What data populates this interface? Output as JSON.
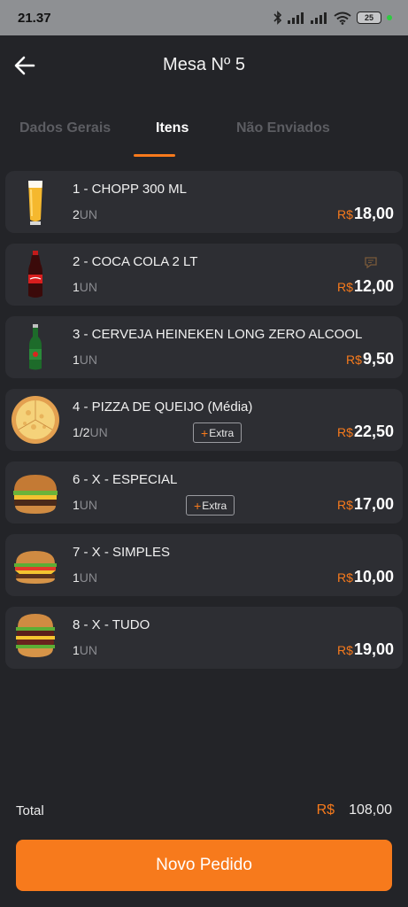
{
  "status_bar": {
    "time": "21.37",
    "battery": "25"
  },
  "header": {
    "title": "Mesa Nº 5"
  },
  "tabs": [
    {
      "label": "Dados Gerais",
      "active": false
    },
    {
      "label": "Itens",
      "active": true
    },
    {
      "label": "Não Enviados",
      "active": false
    }
  ],
  "currency": "R$",
  "items": [
    {
      "name": "1 - CHOPP 300 ML",
      "qty": "2",
      "unit": "UN",
      "price": "18,00",
      "image": "beer-glass",
      "has_note": false,
      "has_extra": false
    },
    {
      "name": "2 - COCA COLA 2 LT",
      "qty": "1",
      "unit": "UN",
      "price": "12,00",
      "image": "cola-bottle",
      "has_note": true,
      "has_extra": false
    },
    {
      "name": "3 - CERVEJA HEINEKEN LONG ZERO ALCOOL",
      "qty": "1",
      "unit": "UN",
      "price": "9,50",
      "image": "green-beer-bottle",
      "has_note": false,
      "has_extra": false
    },
    {
      "name": "4 - PIZZA DE QUEIJO (Média)",
      "qty": "1/2",
      "unit": "UN",
      "price": "22,50",
      "image": "cheese-pizza",
      "has_note": false,
      "has_extra": true
    },
    {
      "name": "6 - X - ESPECIAL",
      "qty": "1",
      "unit": "UN",
      "price": "17,00",
      "image": "burger",
      "has_note": false,
      "has_extra": true
    },
    {
      "name": "7 - X - SIMPLES",
      "qty": "1",
      "unit": "UN",
      "price": "10,00",
      "image": "burger",
      "has_note": false,
      "has_extra": false
    },
    {
      "name": "8 - X - TUDO",
      "qty": "1",
      "unit": "UN",
      "price": "19,00",
      "image": "tall-burger",
      "has_note": false,
      "has_extra": false
    }
  ],
  "extra_label": "Extra",
  "extra_plus": "+",
  "total": {
    "label": "Total",
    "currency": "R$",
    "value": "108,00"
  },
  "new_order_label": "Novo Pedido",
  "colors": {
    "accent": "#f77a1c",
    "background": "#232428",
    "card": "#2d2e33"
  }
}
